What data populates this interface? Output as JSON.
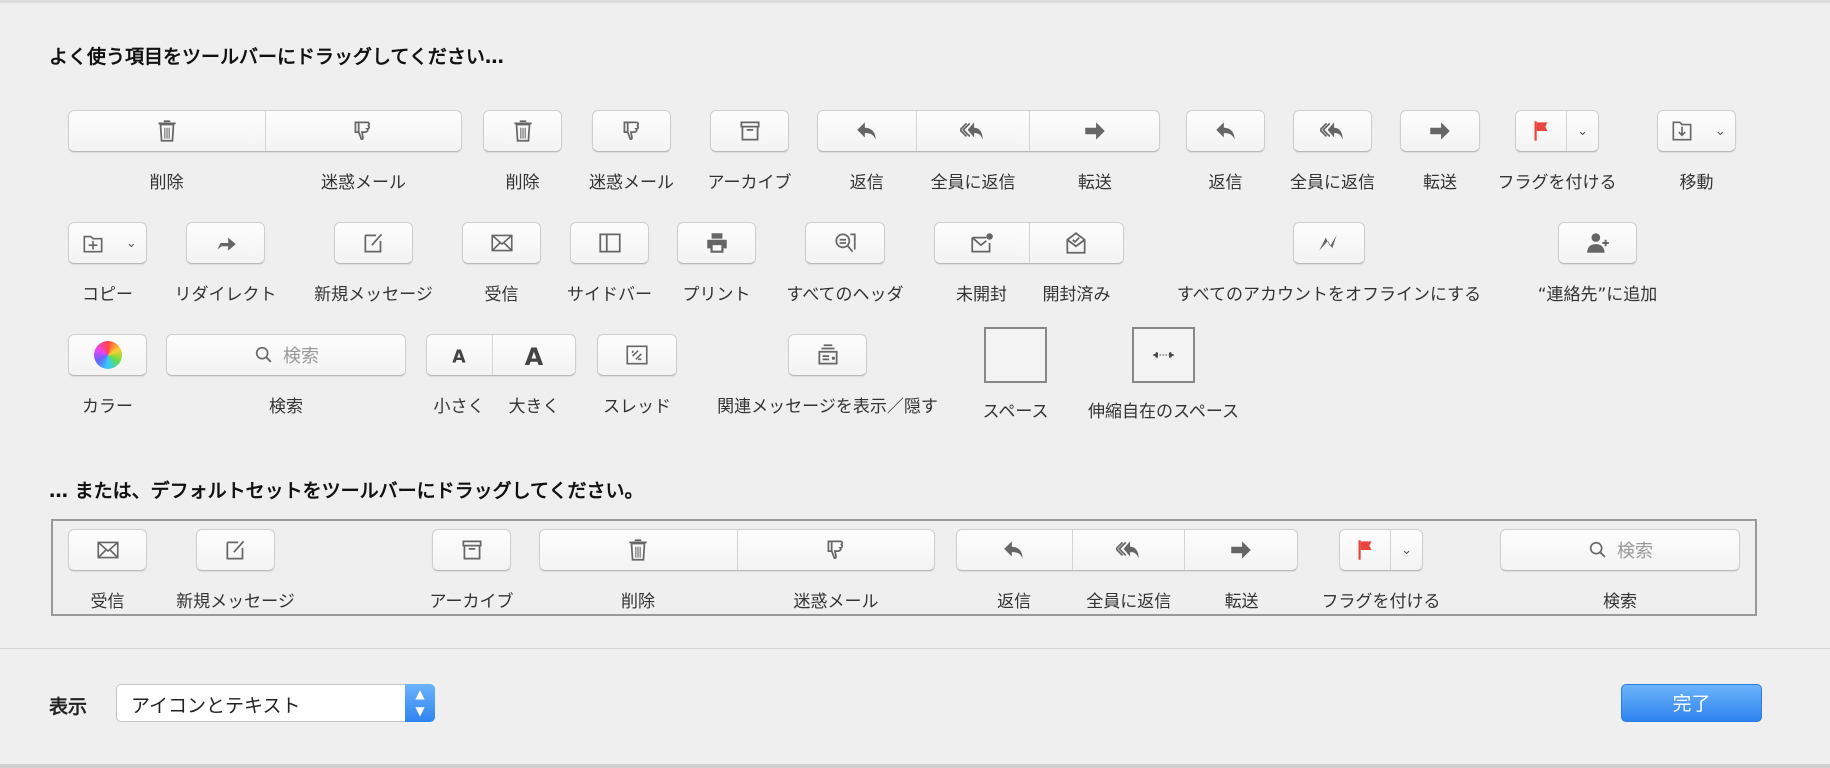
{
  "palette": {
    "title": "よく使う項目をツールバーにドラッグしてください…",
    "items": [
      {
        "segments": [
          {
            "label": "削除",
            "icon": "trash-icon"
          },
          {
            "label": "迷惑メール",
            "icon": "thumbs-down-icon"
          }
        ]
      },
      {
        "segments": [
          {
            "label": "削除",
            "icon": "trash-icon"
          }
        ]
      },
      {
        "segments": [
          {
            "label": "迷惑メール",
            "icon": "thumbs-down-icon"
          }
        ]
      },
      {
        "segments": [
          {
            "label": "アーカイブ",
            "icon": "archive-icon"
          }
        ]
      },
      {
        "segments": [
          {
            "label": "返信",
            "icon": "reply-icon"
          },
          {
            "label": "全員に返信",
            "icon": "reply-all-icon"
          },
          {
            "label": "転送",
            "icon": "forward-icon"
          }
        ]
      },
      {
        "segments": [
          {
            "label": "返信",
            "icon": "reply-icon"
          }
        ]
      },
      {
        "segments": [
          {
            "label": "全員に返信",
            "icon": "reply-all-icon"
          }
        ]
      },
      {
        "segments": [
          {
            "label": "転送",
            "icon": "forward-icon"
          }
        ]
      },
      {
        "segments": [
          {
            "label": "フラグを付ける",
            "icon": "flag-icon"
          }
        ],
        "menu": true
      },
      {
        "segments": [
          {
            "label": "移動",
            "icon": "move-icon"
          }
        ],
        "menu": true
      },
      {
        "segments": [
          {
            "label": "コピー",
            "icon": "copy-icon"
          }
        ],
        "menu": true
      },
      {
        "segments": [
          {
            "label": "リダイレクト",
            "icon": "redirect-icon"
          }
        ]
      },
      {
        "segments": [
          {
            "label": "新規メッセージ",
            "icon": "compose-icon"
          }
        ]
      },
      {
        "segments": [
          {
            "label": "受信",
            "icon": "envelope-icon"
          }
        ]
      },
      {
        "segments": [
          {
            "label": "サイドバー",
            "icon": "sidebar-icon"
          }
        ]
      },
      {
        "segments": [
          {
            "label": "プリント",
            "icon": "printer-icon"
          }
        ]
      },
      {
        "segments": [
          {
            "label": "すべてのヘッダ",
            "icon": "headers-icon"
          }
        ]
      },
      {
        "segments": [
          {
            "label": "未開封",
            "icon": "unread-icon"
          },
          {
            "label": "開封済み",
            "icon": "read-icon"
          }
        ]
      },
      {
        "segments": [
          {
            "label": "すべてのアカウントをオフラインにする",
            "icon": "offline-icon"
          }
        ]
      },
      {
        "segments": [
          {
            "label": "“連絡先”に追加",
            "icon": "add-contact-icon"
          }
        ]
      },
      {
        "segments": [
          {
            "label": "カラー",
            "icon": "color-wheel-icon"
          }
        ]
      },
      {
        "segments": [
          {
            "label": "検索",
            "icon": "search-icon",
            "placeholder": "検索"
          }
        ]
      },
      {
        "segments": [
          {
            "label": "小さく",
            "icon": "font-smaller-icon"
          },
          {
            "label": "大きく",
            "icon": "font-bigger-icon"
          }
        ]
      },
      {
        "segments": [
          {
            "label": "スレッド",
            "icon": "thread-icon"
          }
        ]
      },
      {
        "segments": [
          {
            "label": "関連メッセージを表示／隠す",
            "icon": "related-icon"
          }
        ]
      },
      {
        "segments": [
          {
            "label": "スペース",
            "icon": "space-icon"
          }
        ],
        "kind": "space"
      },
      {
        "segments": [
          {
            "label": "伸縮自在のスペース",
            "icon": "flexible-space-icon"
          }
        ],
        "kind": "flex"
      }
    ]
  },
  "defaults": {
    "title": "… または、デフォルトセットをツールバーにドラッグしてください。",
    "items": [
      {
        "segments": [
          {
            "label": "受信",
            "icon": "envelope-icon"
          }
        ]
      },
      {
        "segments": [
          {
            "label": "新規メッセージ",
            "icon": "compose-icon"
          }
        ]
      },
      {
        "segments": [
          {
            "label": "アーカイブ",
            "icon": "archive-icon"
          }
        ]
      },
      {
        "segments": [
          {
            "label": "削除",
            "icon": "trash-icon"
          },
          {
            "label": "迷惑メール",
            "icon": "thumbs-down-icon"
          }
        ]
      },
      {
        "segments": [
          {
            "label": "返信",
            "icon": "reply-icon"
          },
          {
            "label": "全員に返信",
            "icon": "reply-all-icon"
          },
          {
            "label": "転送",
            "icon": "forward-icon"
          }
        ]
      },
      {
        "segments": [
          {
            "label": "フラグを付ける",
            "icon": "flag-icon"
          }
        ],
        "menu": true
      },
      {
        "segments": [
          {
            "label": "検索",
            "icon": "search-icon",
            "placeholder": "検索"
          }
        ]
      }
    ]
  },
  "footer": {
    "show_label": "表示",
    "show_value": "アイコンとテキスト",
    "done_label": "完了"
  },
  "colors": {
    "accent": "#2f84f0",
    "flag": "#e8453c",
    "icon": "#666666"
  }
}
